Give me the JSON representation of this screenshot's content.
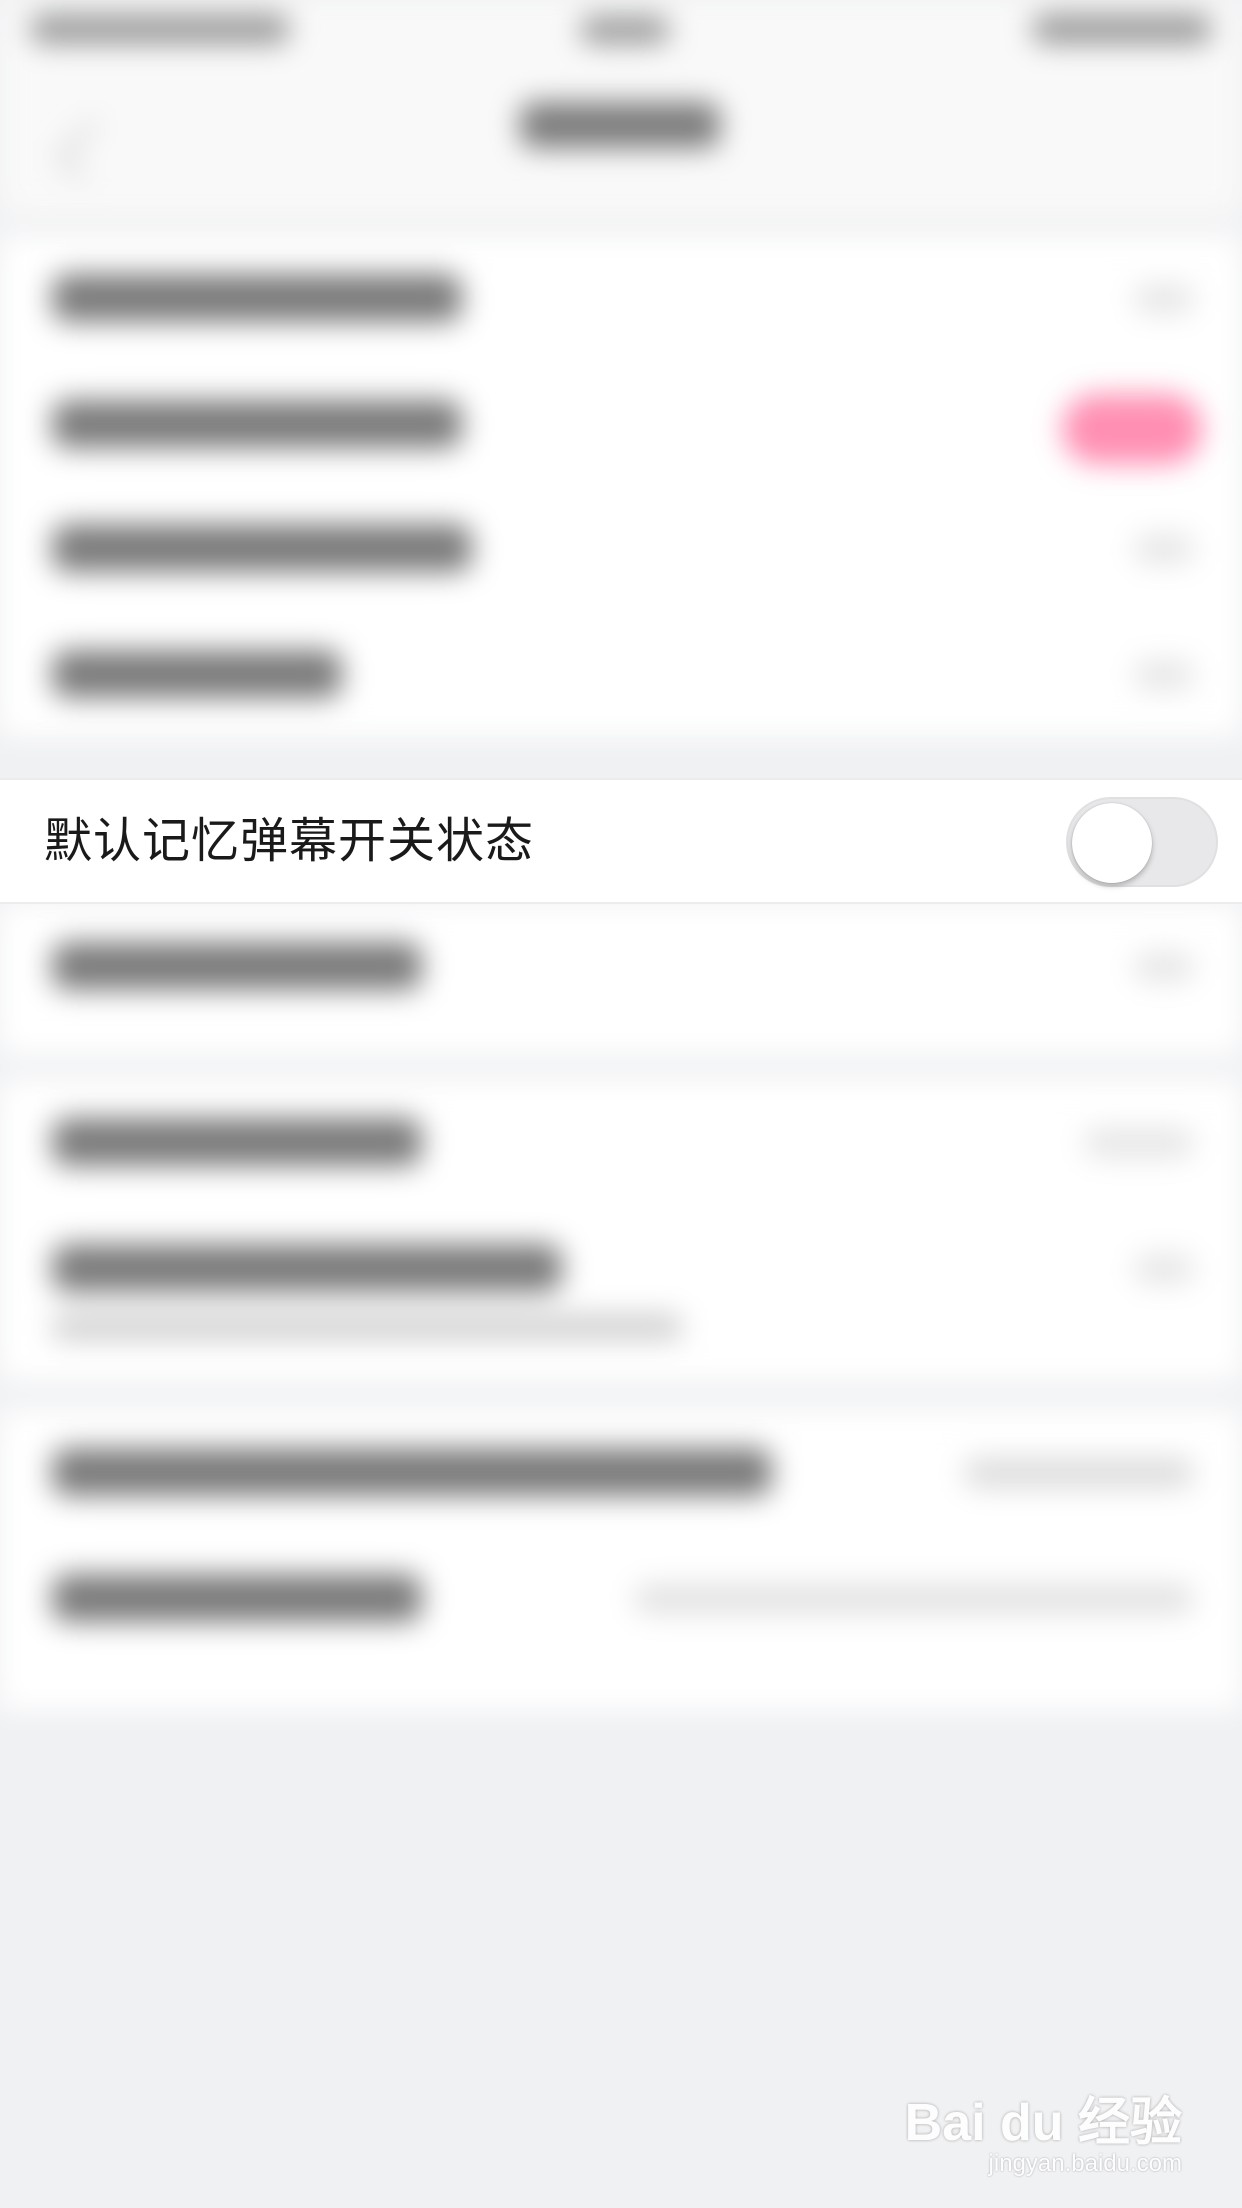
{
  "focused_setting": {
    "label": "默认记忆弹幕开关状态",
    "toggle_on": false
  },
  "watermark": {
    "logo": "Bai du 经验",
    "url": "jingyan.baidu.com"
  },
  "colors": {
    "page_background": "#f0f1f3",
    "row_background": "#ffffff",
    "toggle_off_track": "#e8e8ea",
    "toggle_knob": "#ffffff",
    "blurred_accent_toggle": "#ff8fb3"
  }
}
